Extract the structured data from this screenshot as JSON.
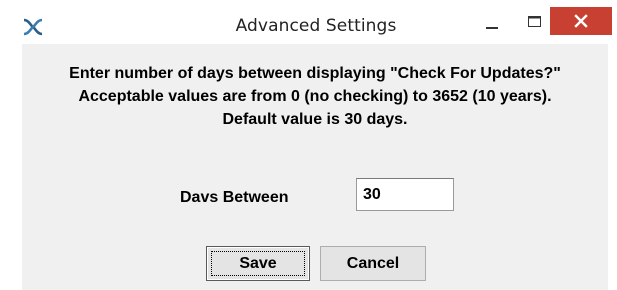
{
  "window": {
    "title": "Advanced Settings"
  },
  "titlebar": {
    "app_icon": "app-logo-icon",
    "minimize_icon": "minimize-icon",
    "maximize_icon": "maximize-icon",
    "close_icon": "close-icon",
    "close_color": "#c84031"
  },
  "message": {
    "line1": "Enter number of days between displaying \"Check For Updates?\"",
    "line2": "Acceptable values are from 0 (no checking) to 3652 (10 years).",
    "line3": "Default value is 30 days."
  },
  "form": {
    "days_label": "Davs Between",
    "days_value": "30"
  },
  "buttons": {
    "save_label": "Save",
    "cancel_label": "Cancel"
  },
  "colors": {
    "client_background": "#f0f0f0",
    "titlebar_background": "#ffffff",
    "accent_icon": "#2a5f8a"
  }
}
